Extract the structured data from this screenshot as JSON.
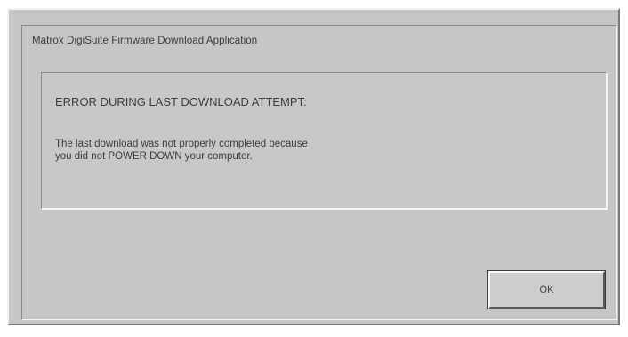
{
  "dialog": {
    "title": "Matrox DigiSuite Firmware Download Application",
    "error_heading": "ERROR DURING LAST DOWNLOAD ATTEMPT:",
    "message_lines": [
      "The last download was not properly completed because",
      "you did not POWER DOWN your computer."
    ],
    "ok_label": "OK"
  }
}
